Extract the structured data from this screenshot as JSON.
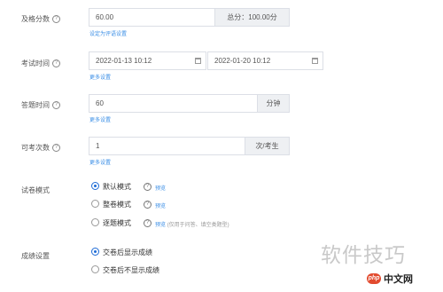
{
  "pass_score": {
    "label": "及格分数",
    "value": "60.00",
    "total": "总分：100.00分",
    "link": "设定为评语设置"
  },
  "exam_time": {
    "label": "考试时间",
    "start": "2022-01-13 10:12",
    "end": "2022-01-20 10:12",
    "link": "更多设置"
  },
  "answer_time": {
    "label": "答题时间",
    "value": "60",
    "unit": "分钟",
    "link": "更多设置"
  },
  "attempts": {
    "label": "可考次数",
    "value": "1",
    "unit": "次/考生",
    "link": "更多设置"
  },
  "paper_mode": {
    "label": "试卷模式",
    "options": [
      {
        "label": "默认模式",
        "selected": true,
        "preview": "预览",
        "note": ""
      },
      {
        "label": "整卷模式",
        "selected": false,
        "preview": "预览",
        "note": ""
      },
      {
        "label": "逐题模式",
        "selected": false,
        "preview": "预览",
        "note": "(仅用于问答、填空类题型)"
      }
    ]
  },
  "score_settings": {
    "label": "成绩设置",
    "options": [
      {
        "label": "交卷后显示成绩",
        "selected": true
      },
      {
        "label": "交卷后不显示成绩",
        "selected": false
      }
    ]
  },
  "watermark": "软件技巧",
  "brand": {
    "badge": "php",
    "text": "中文网"
  },
  "colors": {
    "accent": "#1e6bd6",
    "link": "#3a8ee6",
    "border": "#dcdfe6",
    "addon_bg": "#eef0f3"
  }
}
